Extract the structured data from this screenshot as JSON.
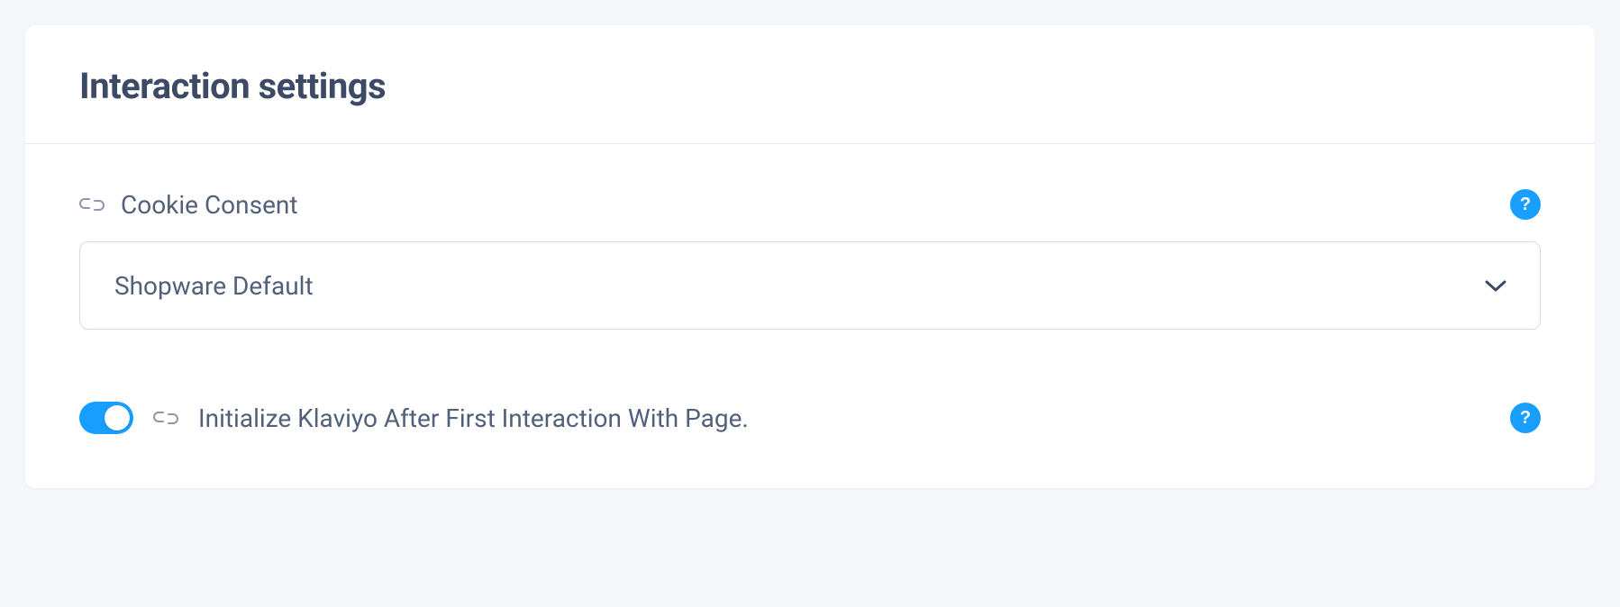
{
  "card": {
    "title": "Interaction settings"
  },
  "fields": {
    "cookieConsent": {
      "label": "Cookie Consent",
      "selectedValue": "Shopware Default"
    },
    "initializeKlaviyo": {
      "label": "Initialize Klaviyo After First Interaction With Page.",
      "enabled": true
    }
  },
  "help": {
    "symbol": "?"
  }
}
